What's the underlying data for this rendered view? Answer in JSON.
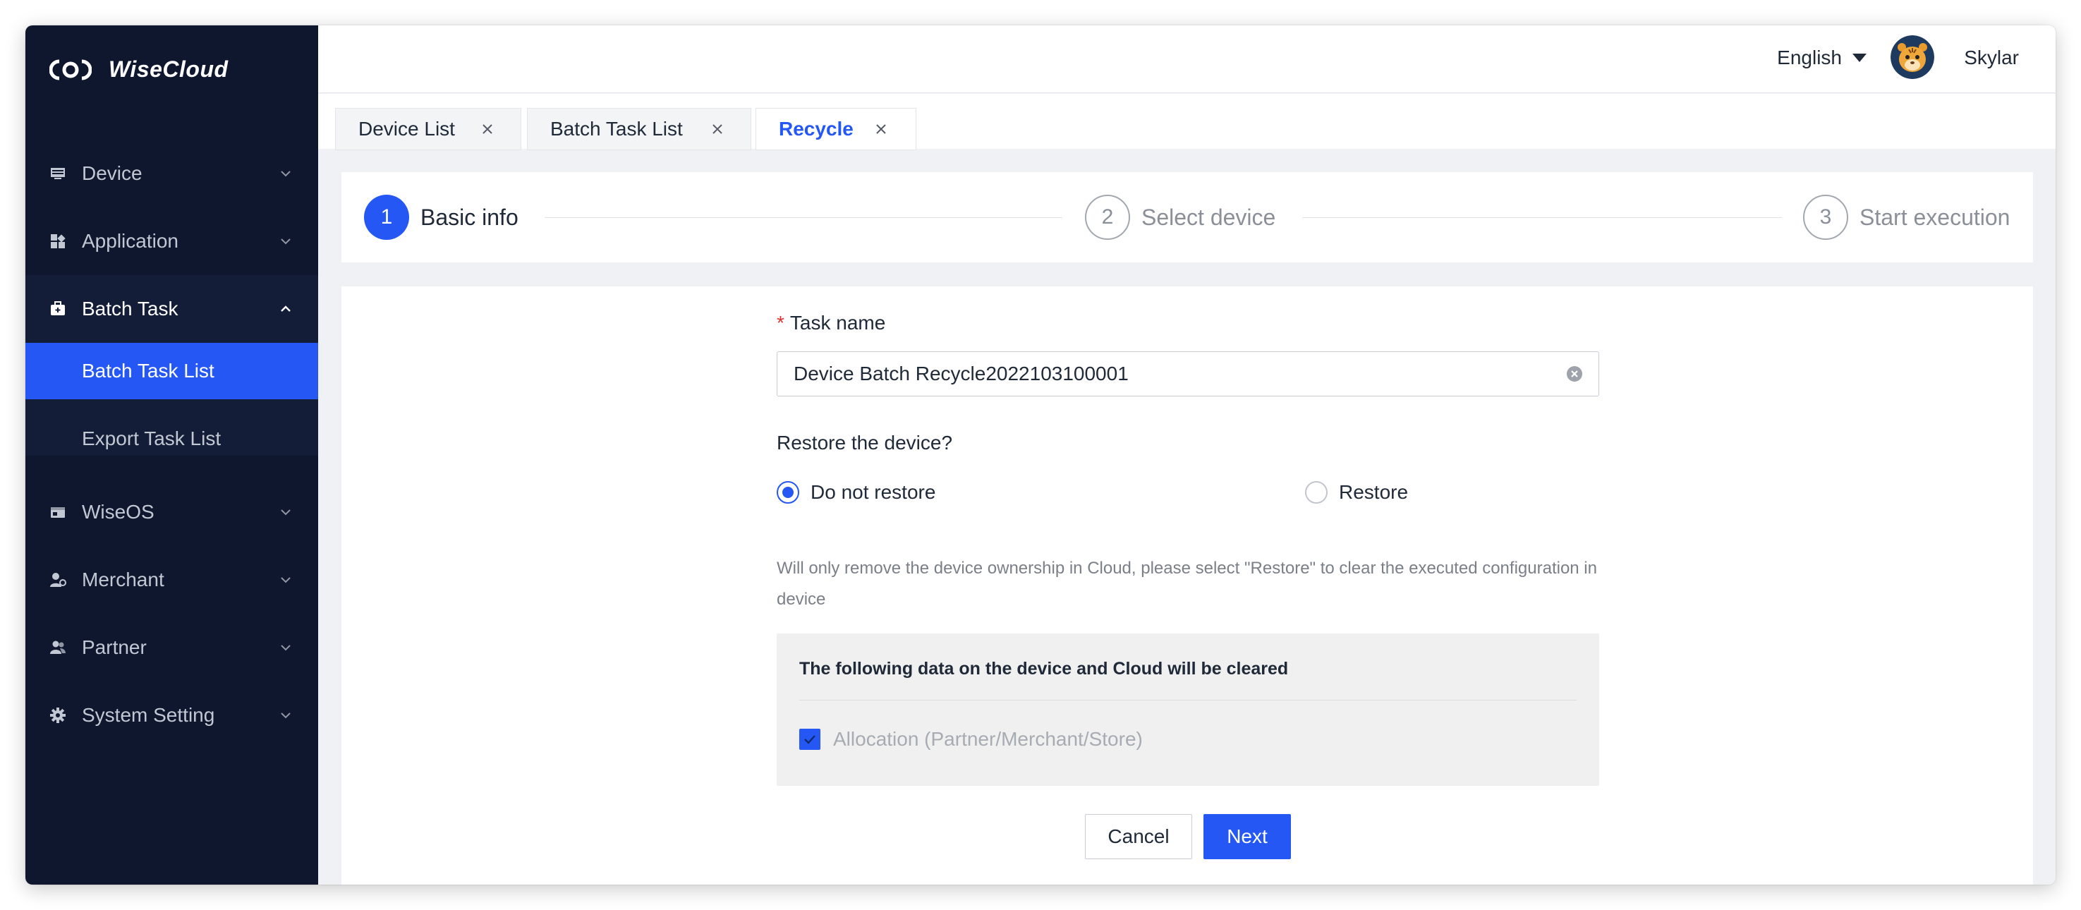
{
  "app": {
    "name": "WiseCloud"
  },
  "sidebar": {
    "items": [
      {
        "label": "Device",
        "icon": "device-icon",
        "expanded": false
      },
      {
        "label": "Application",
        "icon": "application-icon",
        "expanded": false
      },
      {
        "label": "Batch Task",
        "icon": "batch-task-icon",
        "expanded": true,
        "children": [
          {
            "label": "Batch Task List",
            "active": true
          },
          {
            "label": "Export Task List",
            "active": false
          }
        ]
      },
      {
        "label": "WiseOS",
        "icon": "wiseos-icon",
        "expanded": false
      },
      {
        "label": "Merchant",
        "icon": "merchant-icon",
        "expanded": false
      },
      {
        "label": "Partner",
        "icon": "partner-icon",
        "expanded": false
      },
      {
        "label": "System Setting",
        "icon": "gear-icon",
        "expanded": false
      }
    ]
  },
  "header": {
    "language": "English",
    "username": "Skylar"
  },
  "tabs": [
    {
      "label": "Device List",
      "active": false
    },
    {
      "label": "Batch Task List",
      "active": false
    },
    {
      "label": "Recycle",
      "active": true
    }
  ],
  "steps": [
    {
      "number": "1",
      "label": "Basic info",
      "state": "current"
    },
    {
      "number": "2",
      "label": "Select device",
      "state": "todo"
    },
    {
      "number": "3",
      "label": "Start execution",
      "state": "todo"
    }
  ],
  "form": {
    "task_name": {
      "required_mark": "*",
      "label": "Task name",
      "value": "Device Batch Recycle2022103100001"
    },
    "restore": {
      "label": "Restore the device?",
      "options": [
        {
          "label": "Do not restore",
          "checked": true
        },
        {
          "label": "Restore",
          "checked": false
        }
      ],
      "hint": "Will only remove the device ownership in Cloud, please select \"Restore\" to clear the executed configuration in device"
    },
    "cleared_box": {
      "title": "The following data on the device and Cloud will be cleared",
      "items": [
        {
          "label": "Allocation (Partner/Merchant/Store)",
          "checked": true,
          "disabled": true
        }
      ]
    },
    "buttons": {
      "cancel": "Cancel",
      "next": "Next"
    }
  },
  "colors": {
    "sidebar_bg": "#0f172e",
    "accent": "#2557f5",
    "required": "#e0342f"
  }
}
